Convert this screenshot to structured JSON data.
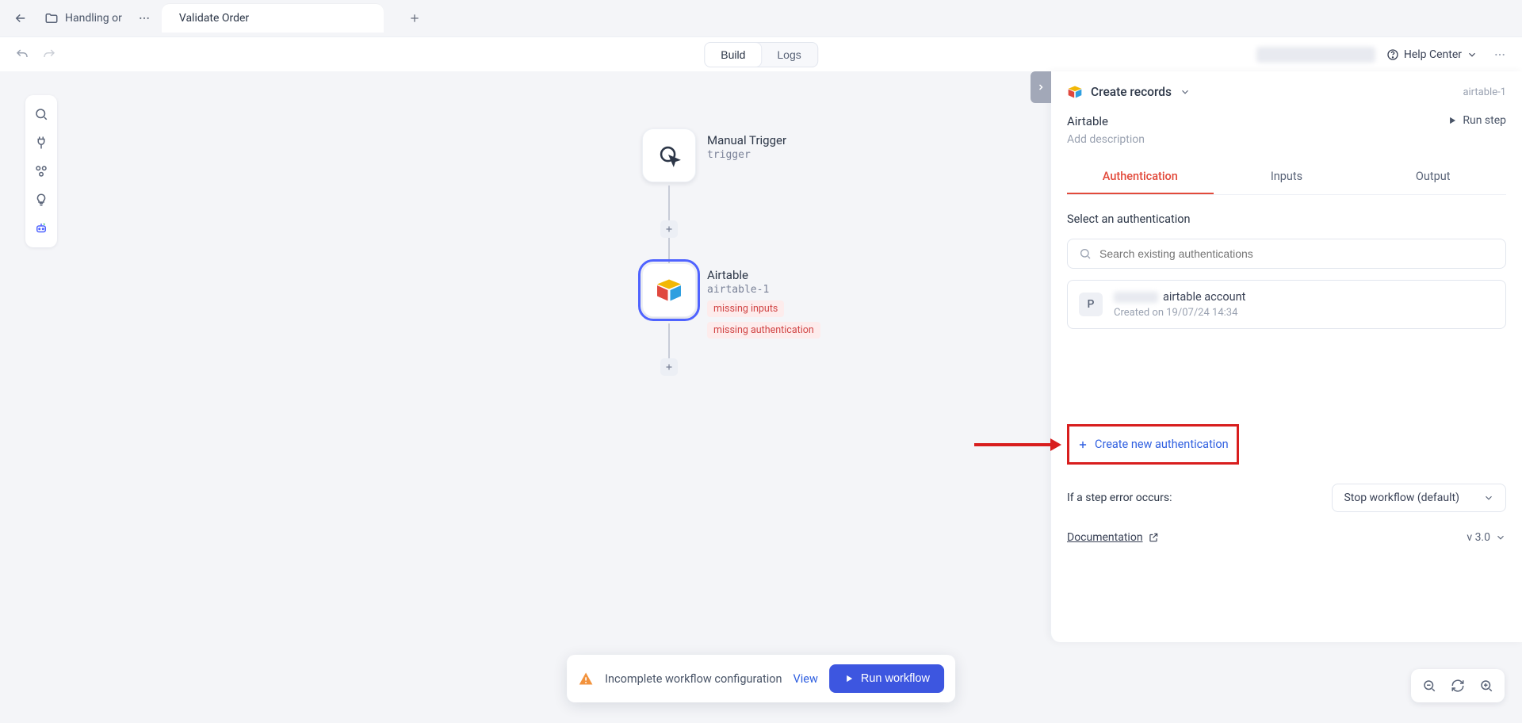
{
  "header": {
    "folder_label": "Handling or",
    "active_tab": "Validate Order"
  },
  "toolbar": {
    "segments": {
      "build": "Build",
      "logs": "Logs"
    },
    "help_label": "Help Center"
  },
  "canvas": {
    "trigger": {
      "title": "Manual Trigger",
      "subtitle": "trigger"
    },
    "airtable": {
      "title": "Airtable",
      "subtitle": "airtable-1",
      "err_inputs": "missing inputs",
      "err_auth": "missing authentication"
    }
  },
  "panel": {
    "title": "Create records",
    "id": "airtable-1",
    "service": "Airtable",
    "desc_placeholder": "Add description",
    "run_step": "Run step",
    "tabs": {
      "auth": "Authentication",
      "inputs": "Inputs",
      "output": "Output"
    },
    "auth_section_label": "Select an authentication",
    "search_placeholder": "Search existing authentications",
    "existing_auth": {
      "avatar_letter": "P",
      "name_suffix": "airtable account",
      "created": "Created on 19/07/24 14:34"
    },
    "create_new": "Create new authentication",
    "step_error_label": "If a step error occurs:",
    "step_error_value": "Stop workflow (default)",
    "doc_label": "Documentation",
    "version": "v 3.0"
  },
  "toast": {
    "text": "Incomplete workflow configuration",
    "view": "View",
    "run": "Run workflow"
  }
}
